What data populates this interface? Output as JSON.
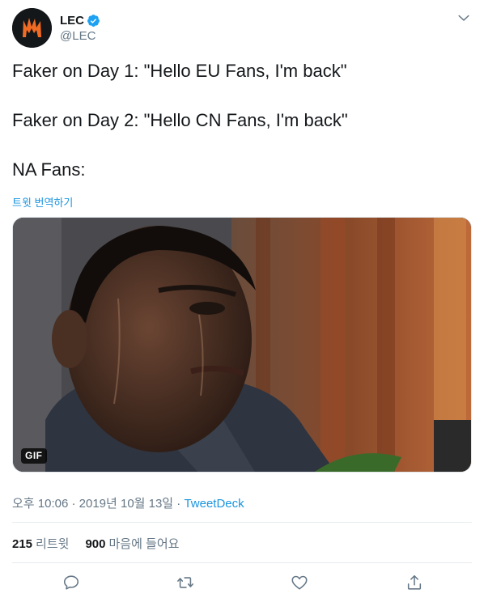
{
  "account": {
    "name": "LEC",
    "handle": "@LEC",
    "avatar_icon": "lec-logo-icon",
    "verified_icon": "verified-badge-icon",
    "menu_icon": "chevron-down-icon"
  },
  "tweet": {
    "lines": [
      "Faker on Day 1: \"Hello EU Fans, I'm back\"",
      "Faker on Day 2: \"Hello CN Fans, I'm back\"",
      "NA Fans:"
    ],
    "translate_label": "트윗 번역하기",
    "media": {
      "badge": "GIF"
    },
    "timestamp": "오후 10:06 · 2019년 10월 13일",
    "separator": " · ",
    "source": "TweetDeck"
  },
  "stats": {
    "retweets_count": "215",
    "retweets_label": "리트윗",
    "likes_count": "900",
    "likes_label": "마음에 들어요"
  },
  "actions": {
    "reply_icon": "reply-icon",
    "retweet_icon": "retweet-icon",
    "like_icon": "heart-icon",
    "share_icon": "share-icon"
  },
  "colors": {
    "link": "#1b95e0",
    "text": "#14171a",
    "secondary": "#657786",
    "verified": "#1da1f2",
    "logo_orange": "#f26b23"
  }
}
